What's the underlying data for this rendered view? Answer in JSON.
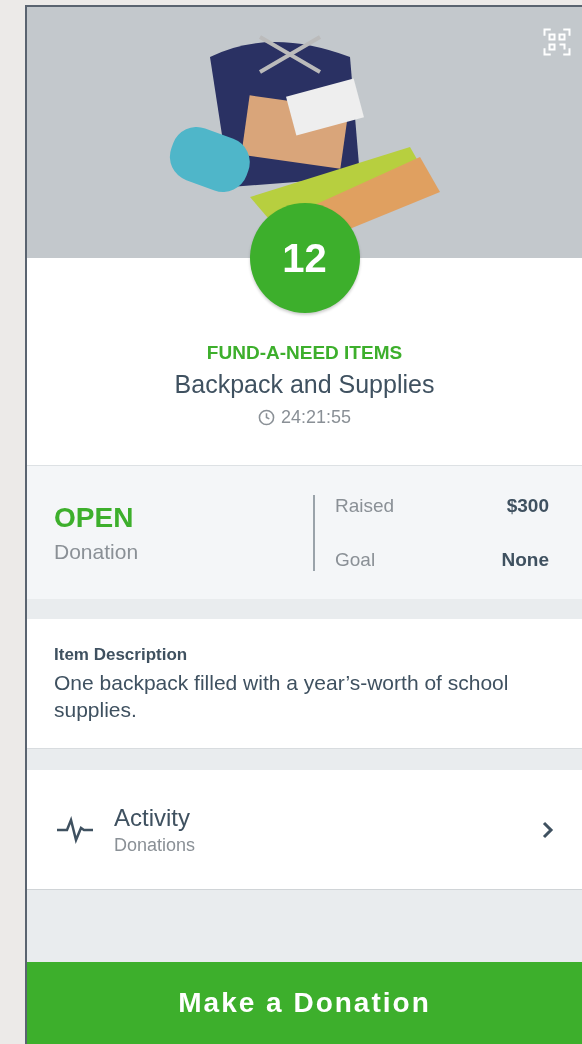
{
  "item": {
    "number": "12",
    "category": "FUND-A-NEED ITEMS",
    "name": "Backpack and Supplies",
    "timer": "24:21:55"
  },
  "status": {
    "state": "OPEN",
    "type": "Donation"
  },
  "stats": [
    {
      "label": "Raised",
      "value": "$300"
    },
    {
      "label": "Goal",
      "value": "None"
    }
  ],
  "description": {
    "heading": "Item Description",
    "text": "One backpack filled with a year’s-worth of school supplies."
  },
  "activity": {
    "title": "Activity",
    "subtitle": "Donations"
  },
  "action_button": "Make a Donation"
}
